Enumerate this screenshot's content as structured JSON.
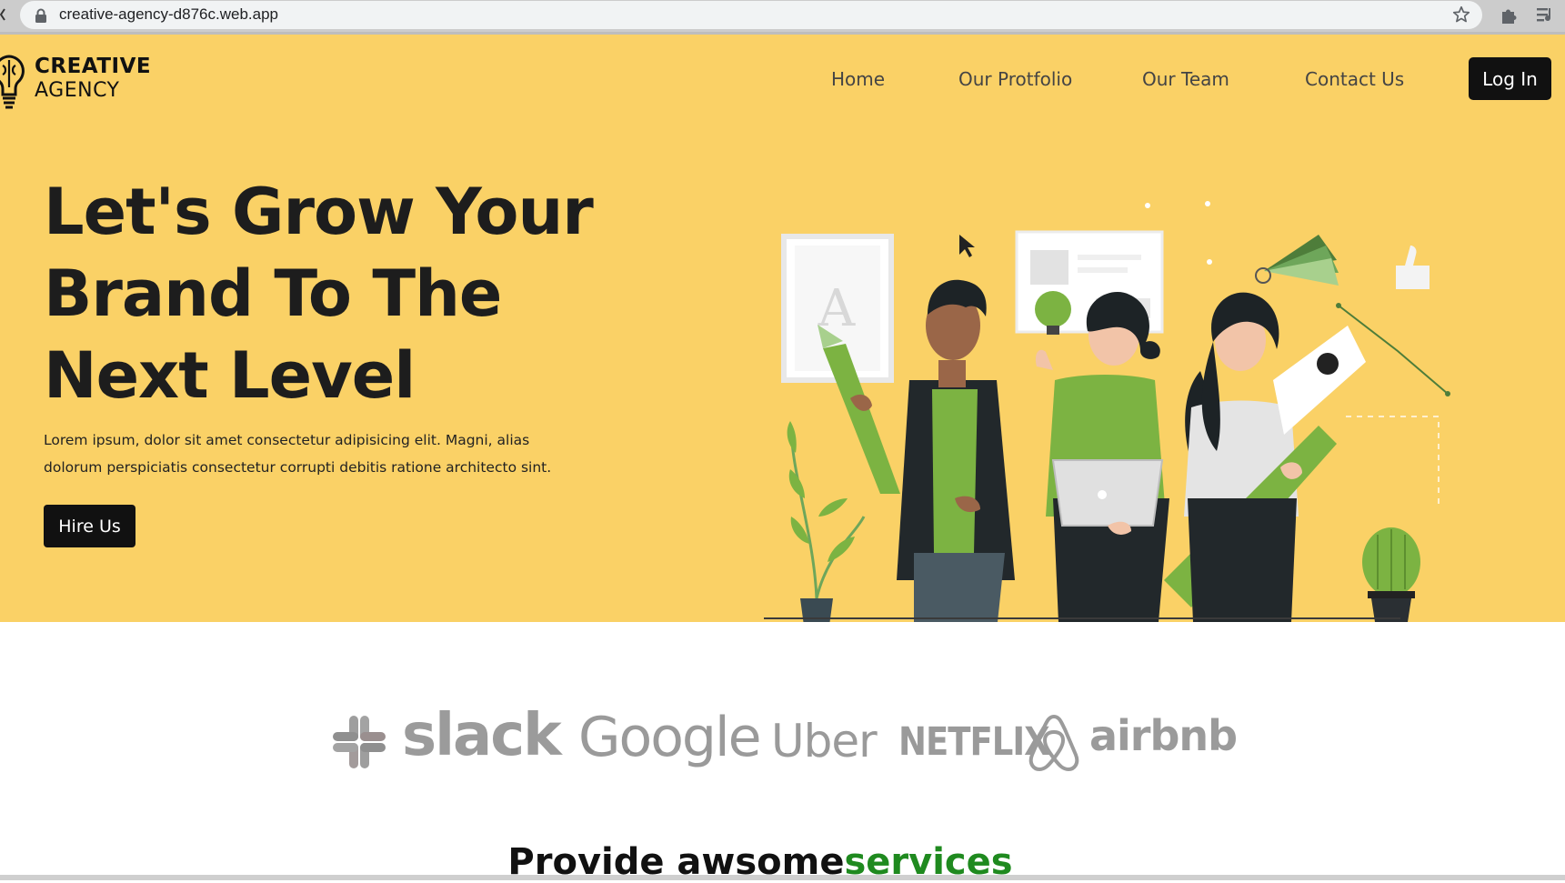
{
  "browser": {
    "url": "creative-agency-d876c.web.app"
  },
  "header": {
    "logo_line1": "CREATIVE",
    "logo_line2": "AGENCY",
    "nav": [
      "Home",
      "Our Protfolio",
      "Our Team",
      "Contact Us"
    ],
    "login_label": "Log In"
  },
  "hero": {
    "title_lines": [
      "Let's Grow Your",
      "Brand To The",
      "Next Level"
    ],
    "description_lines": [
      "Lorem ipsum, dolor sit amet consectetur adipisicing elit. Magni, alias",
      "dolorum perspiciatis consectetur corrupti debitis ratione architecto sint."
    ],
    "cta_label": "Hire Us"
  },
  "clients": [
    "slack",
    "Google",
    "Uber",
    "NETFLIX",
    "airbnb"
  ],
  "services": {
    "title_part1": "Provide awsome",
    "title_part2": "services"
  },
  "colors": {
    "hero_bg": "#fad166",
    "button_bg": "#111111",
    "accent_green": "#1f8a1f",
    "illustration_green": "#7cb342"
  }
}
